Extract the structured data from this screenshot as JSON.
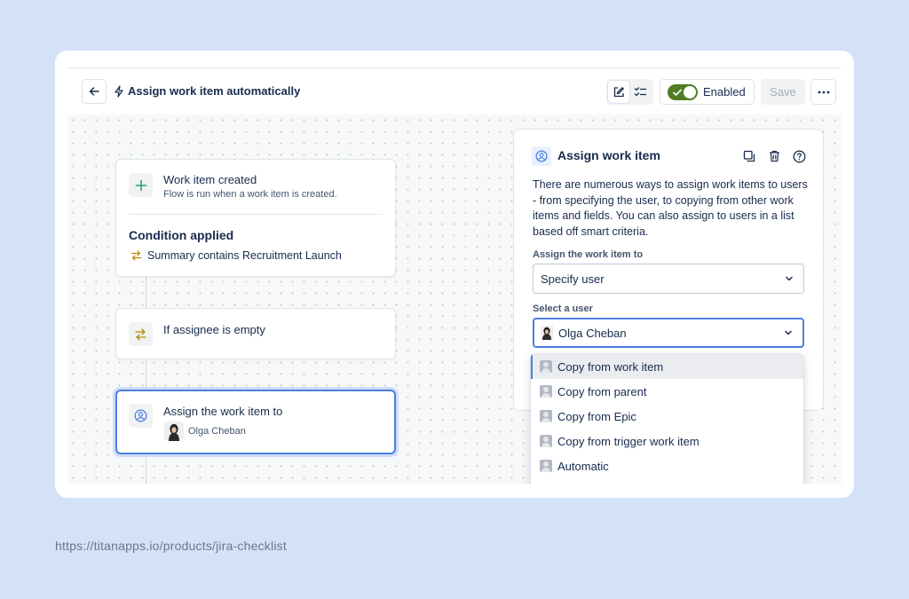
{
  "header": {
    "title": "Assign work item automatically",
    "enabled_label": "Enabled",
    "save_label": "Save",
    "enabled": true
  },
  "flow": {
    "trigger": {
      "title": "Work item created",
      "subtitle": "Flow is run when a work item is created."
    },
    "condition": {
      "title": "Condition applied",
      "text": "Summary contains Recruitment Launch"
    },
    "if_node": {
      "title": "If assignee is empty"
    },
    "action_node": {
      "title": "Assign the work item to",
      "user": "Olga Cheban"
    }
  },
  "panel": {
    "title": "Assign work item",
    "description": "There are numerous ways to assign work items to users - from specifying the user, to copying from other work items and fields. You can also assign to users in a list based off smart criteria.",
    "assign_label": "Assign the work item to",
    "assign_value": "Specify user",
    "select_user_label": "Select a user",
    "select_user_value": "Olga Cheban"
  },
  "dropdown": {
    "items": [
      "Copy from work item",
      "Copy from parent",
      "Copy from Epic",
      "Copy from trigger work item",
      "Automatic"
    ]
  },
  "footer": {
    "url": "https://titanapps.io/products/jira-checklist"
  },
  "colors": {
    "background": "#d4e2f8",
    "toggle_on": "#4f7d24",
    "focus_blue": "#4c7fe0",
    "plus_green": "#22a06b",
    "condition_amber": "#b38600"
  }
}
